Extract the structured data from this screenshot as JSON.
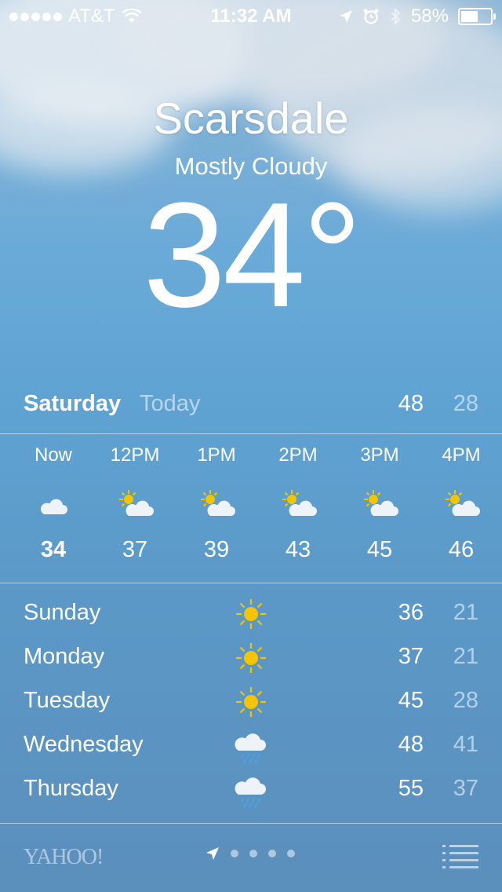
{
  "status_bar": {
    "carrier": "AT&T",
    "time": "11:32 AM",
    "battery": "58%",
    "battery_level": 0.58
  },
  "location": {
    "city": "Scarsdale",
    "condition": "Mostly Cloudy",
    "temperature": "34°"
  },
  "today": {
    "day": "Saturday",
    "label": "Today",
    "high": "48",
    "low": "28"
  },
  "hourly": [
    {
      "time": "Now",
      "temp": "34",
      "icon": "cloud-icon"
    },
    {
      "time": "12PM",
      "temp": "37",
      "icon": "partly-cloudy-icon"
    },
    {
      "time": "1PM",
      "temp": "39",
      "icon": "partly-cloudy-icon"
    },
    {
      "time": "2PM",
      "temp": "43",
      "icon": "partly-cloudy-icon"
    },
    {
      "time": "3PM",
      "temp": "45",
      "icon": "partly-cloudy-icon"
    },
    {
      "time": "4PM",
      "temp": "46",
      "icon": "partly-cloudy-icon"
    }
  ],
  "daily": [
    {
      "day": "Sunday",
      "high": "36",
      "low": "21",
      "icon": "sun-icon"
    },
    {
      "day": "Monday",
      "high": "37",
      "low": "21",
      "icon": "sun-icon"
    },
    {
      "day": "Tuesday",
      "high": "45",
      "low": "28",
      "icon": "sun-icon"
    },
    {
      "day": "Wednesday",
      "high": "48",
      "low": "41",
      "icon": "rain-cloud-icon"
    },
    {
      "day": "Thursday",
      "high": "55",
      "low": "37",
      "icon": "rain-cloud-icon"
    }
  ],
  "footer": {
    "provider": "YAHOO!"
  },
  "colors": {
    "sun": "#f5c400",
    "rain": "#4aa3e8"
  }
}
